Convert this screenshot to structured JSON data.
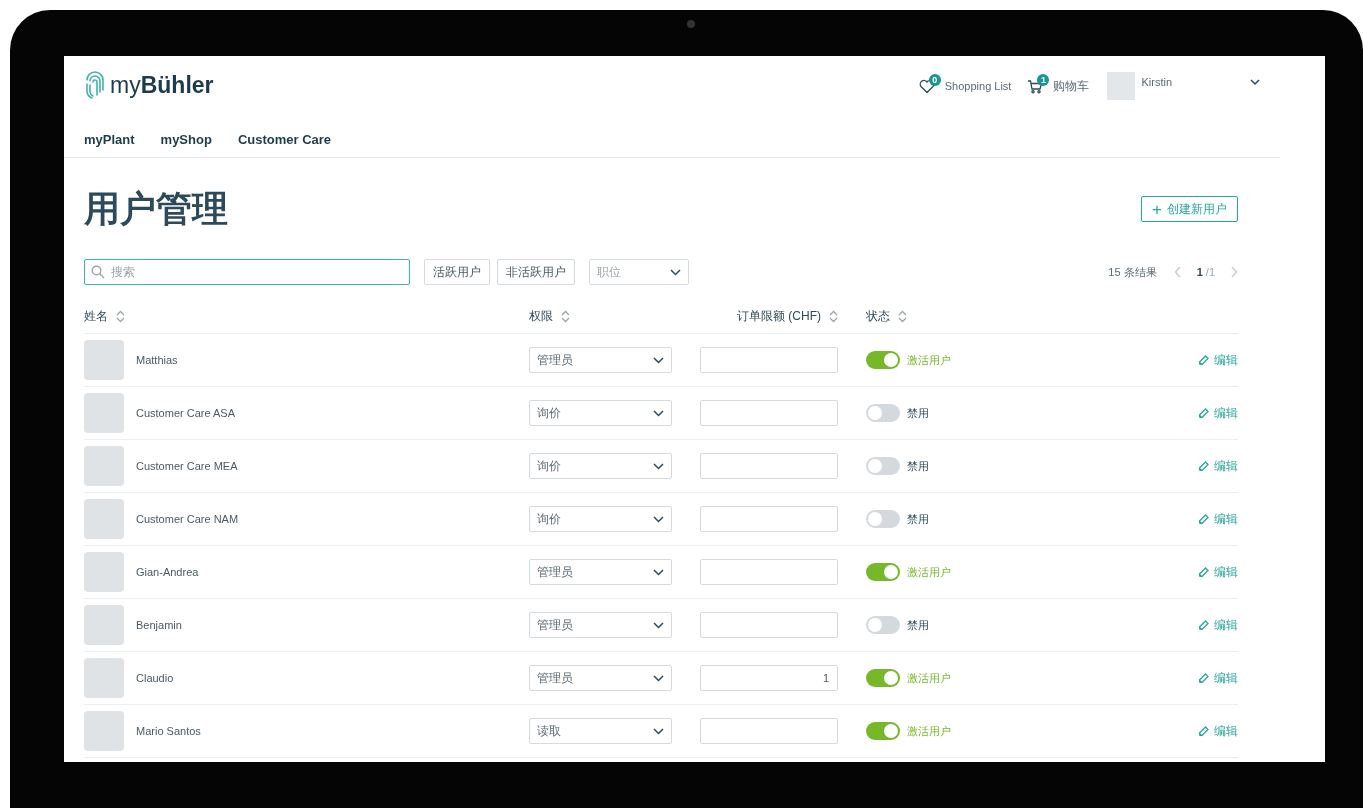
{
  "header": {
    "logo": {
      "prefix": "my",
      "brand": "Bühler"
    },
    "shopping_list": {
      "count": "0",
      "label": "Shopping List"
    },
    "cart": {
      "count": "1",
      "label": "购物车"
    },
    "user": {
      "name": "Kirstin"
    }
  },
  "nav": [
    "myPlant",
    "myShop",
    "Customer Care"
  ],
  "page_title": "用户管理",
  "create_button": {
    "icon": "+",
    "label": "创建新用户"
  },
  "toolbar": {
    "search": {
      "placeholder": "搜索"
    },
    "filters": [
      "活跃用户",
      "非活跃用户"
    ],
    "role_select": {
      "placeholder": "职位"
    },
    "results": "15 条结果",
    "pagination": {
      "current": "1",
      "total": "/1"
    }
  },
  "table": {
    "columns": [
      "姓名",
      "权限",
      "订单限额 (CHF)",
      "状态"
    ],
    "rows": [
      {
        "name": "Matthias",
        "role": "管理员",
        "limit": "",
        "active": true,
        "status": "激活用户",
        "edit": "编辑"
      },
      {
        "name": "Customer Care ASA",
        "role": "询价",
        "limit": "",
        "active": false,
        "status": "禁用",
        "edit": "编辑"
      },
      {
        "name": "Customer Care MEA",
        "role": "询价",
        "limit": "",
        "active": false,
        "status": "禁用",
        "edit": "编辑"
      },
      {
        "name": "Customer Care NAM",
        "role": "询价",
        "limit": "",
        "active": false,
        "status": "禁用",
        "edit": "编辑"
      },
      {
        "name": "Gian-Andrea",
        "role": "管理员",
        "limit": "",
        "active": true,
        "status": "激活用户",
        "edit": "编辑"
      },
      {
        "name": "Benjamin",
        "role": "管理员",
        "limit": "",
        "active": false,
        "status": "禁用",
        "edit": "编辑"
      },
      {
        "name": "Claudio",
        "role": "管理员",
        "limit": "1",
        "active": true,
        "status": "激活用户",
        "edit": "编辑"
      },
      {
        "name": "Mario Santos",
        "role": "读取",
        "limit": "",
        "active": true,
        "status": "激活用户",
        "edit": "编辑"
      }
    ]
  }
}
